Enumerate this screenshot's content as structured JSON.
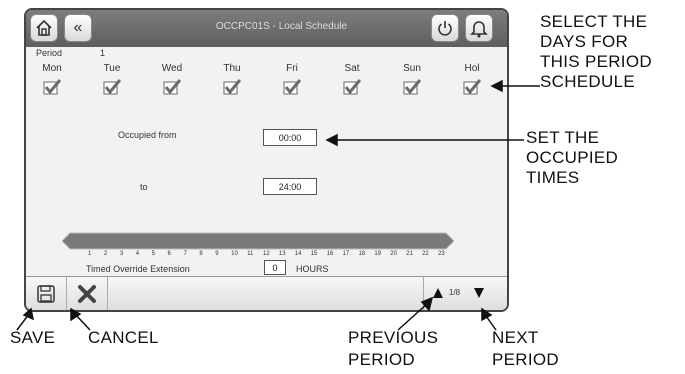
{
  "window": {
    "title": "OCCPC01S - Local Schedule"
  },
  "period": {
    "label": "Period",
    "value": "1"
  },
  "days": [
    {
      "label": "Mon",
      "checked": true
    },
    {
      "label": "Tue",
      "checked": true
    },
    {
      "label": "Wed",
      "checked": true
    },
    {
      "label": "Thu",
      "checked": true
    },
    {
      "label": "Fri",
      "checked": true
    },
    {
      "label": "Sat",
      "checked": true
    },
    {
      "label": "Sun",
      "checked": true
    },
    {
      "label": "Hol",
      "checked": true
    }
  ],
  "occupied": {
    "from_label": "Occupied from",
    "from_value": "00:00",
    "to_label": "to",
    "to_value": "24:00"
  },
  "timeline": {
    "ticks": [
      "1",
      "2",
      "3",
      "4",
      "5",
      "6",
      "7",
      "8",
      "9",
      "10",
      "11",
      "12",
      "13",
      "14",
      "15",
      "16",
      "17",
      "18",
      "19",
      "20",
      "21",
      "22",
      "23"
    ]
  },
  "override": {
    "label": "Timed Override Extension",
    "value": "0",
    "unit": "HOURS"
  },
  "pager": {
    "text": "1/8"
  },
  "annotations": {
    "select_days": [
      "SELECT THE",
      "DAYS FOR",
      "THIS PERIOD",
      "SCHEDULE"
    ],
    "set_times": [
      "SET THE",
      "OCCUPIED",
      "TIMES"
    ],
    "save": "SAVE",
    "cancel": "CANCEL",
    "previous": [
      "PREVIOUS",
      "PERIOD"
    ],
    "next": [
      "NEXT",
      "PERIOD"
    ]
  },
  "colors": {
    "titlebar": "#6e6e6e",
    "panel": "#f2f2f2",
    "timeline": "#7a7a7a"
  }
}
